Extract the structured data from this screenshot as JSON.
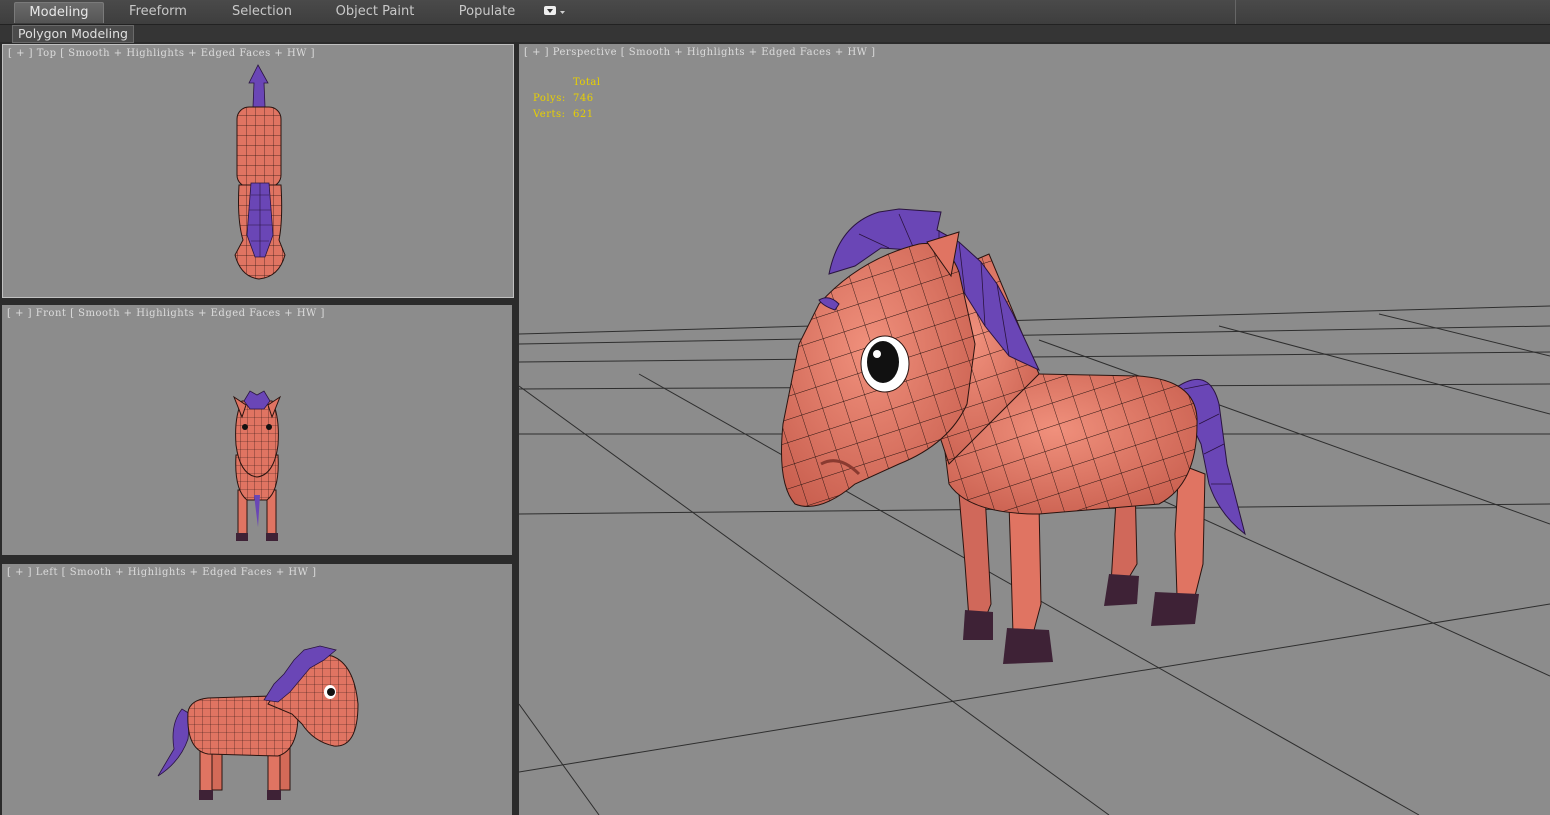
{
  "ribbon": {
    "tabs": [
      {
        "label": "Modeling",
        "active": true
      },
      {
        "label": "Freeform",
        "active": false
      },
      {
        "label": "Selection",
        "active": false
      },
      {
        "label": "Object Paint",
        "active": false
      },
      {
        "label": "Populate",
        "active": false
      }
    ],
    "dropdown_icon": "panel-dropdown-icon"
  },
  "subbar": {
    "polygon_modeling": "Polygon Modeling"
  },
  "viewports": {
    "top": {
      "label": "[ + ] Top [ Smooth + Highlights + Edged Faces + HW ]"
    },
    "front": {
      "label": "[ + ] Front [ Smooth + Highlights + Edged Faces + HW ]"
    },
    "left": {
      "label": "[ + ] Left [ Smooth + Highlights + Edged Faces + HW ]"
    },
    "perspective": {
      "label": "[ + ] Perspective [ Smooth + Highlights + Edged Faces + HW ]",
      "stats": {
        "header": "Total",
        "polys_label": "Polys:",
        "polys_value": "746",
        "verts_label": "Verts:",
        "verts_value": "621"
      }
    }
  },
  "colors": {
    "viewport_bg": "#8c8c8c",
    "horse_body": "#e07462",
    "horse_mane": "#6a46b6",
    "hooves": "#3e2236",
    "stats_text": "#e8d000"
  }
}
